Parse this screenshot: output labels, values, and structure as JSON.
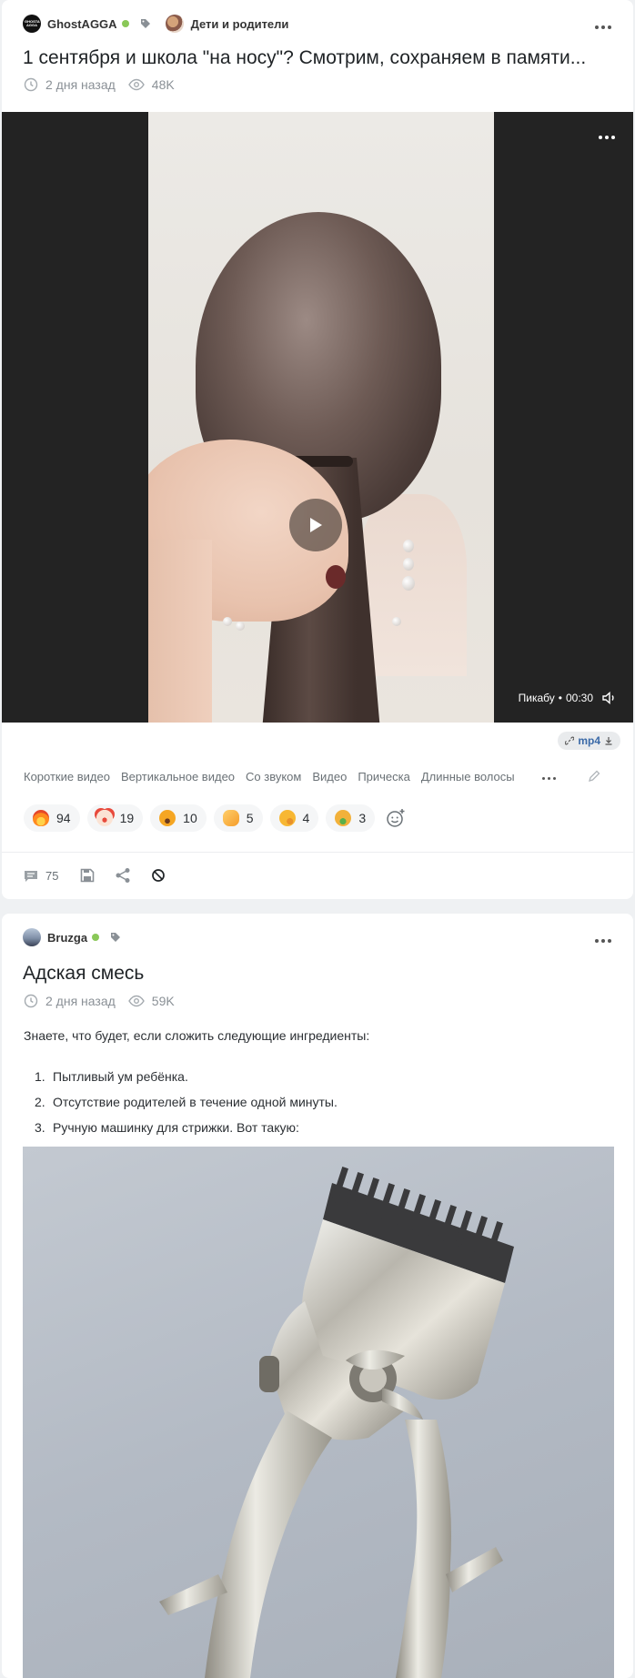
{
  "post1": {
    "author": "GhostAGGA",
    "avatar_text": "GHOSTA AGGA",
    "community": "Дети и родители",
    "title": "1 сентября и школа \"на носу\"? Смотрим, сохраняем в памяти...",
    "time": "2 дня назад",
    "views": "48K",
    "video": {
      "source": "Пикабу",
      "duration": "00:30"
    },
    "download_label": "mp4",
    "tags": [
      "Короткие видео",
      "Вертикальное видео",
      "Со звуком",
      "Видео",
      "Прическа",
      "Длинные волосы"
    ],
    "reactions": [
      {
        "icon": "fire-emoji",
        "count": "94"
      },
      {
        "icon": "clown-emoji",
        "count": "19"
      },
      {
        "icon": "scared-emoji",
        "count": "10"
      },
      {
        "icon": "clap-emoji",
        "count": "5"
      },
      {
        "icon": "thinking-emoji",
        "count": "4"
      },
      {
        "icon": "nauseated-emoji",
        "count": "3"
      }
    ],
    "comments_count": "75"
  },
  "post2": {
    "author": "Bruzga",
    "title": "Адская смесь",
    "time": "2 дня назад",
    "views": "59K",
    "intro": "Знаете, что будет, если сложить следующие ингредиенты:",
    "list": [
      {
        "num": "1.",
        "text": "Пытливый ум ребёнка."
      },
      {
        "num": "2.",
        "text": "Отсутствие родителей в течение одной минуты."
      },
      {
        "num": "3.",
        "text": "Ручную машинку для стрижки. Вот такую:"
      }
    ]
  },
  "colors": {
    "online": "#8ac858",
    "link": "#3b6aa8",
    "video_bg": "#232323",
    "page_bg": "#eff1f3"
  }
}
